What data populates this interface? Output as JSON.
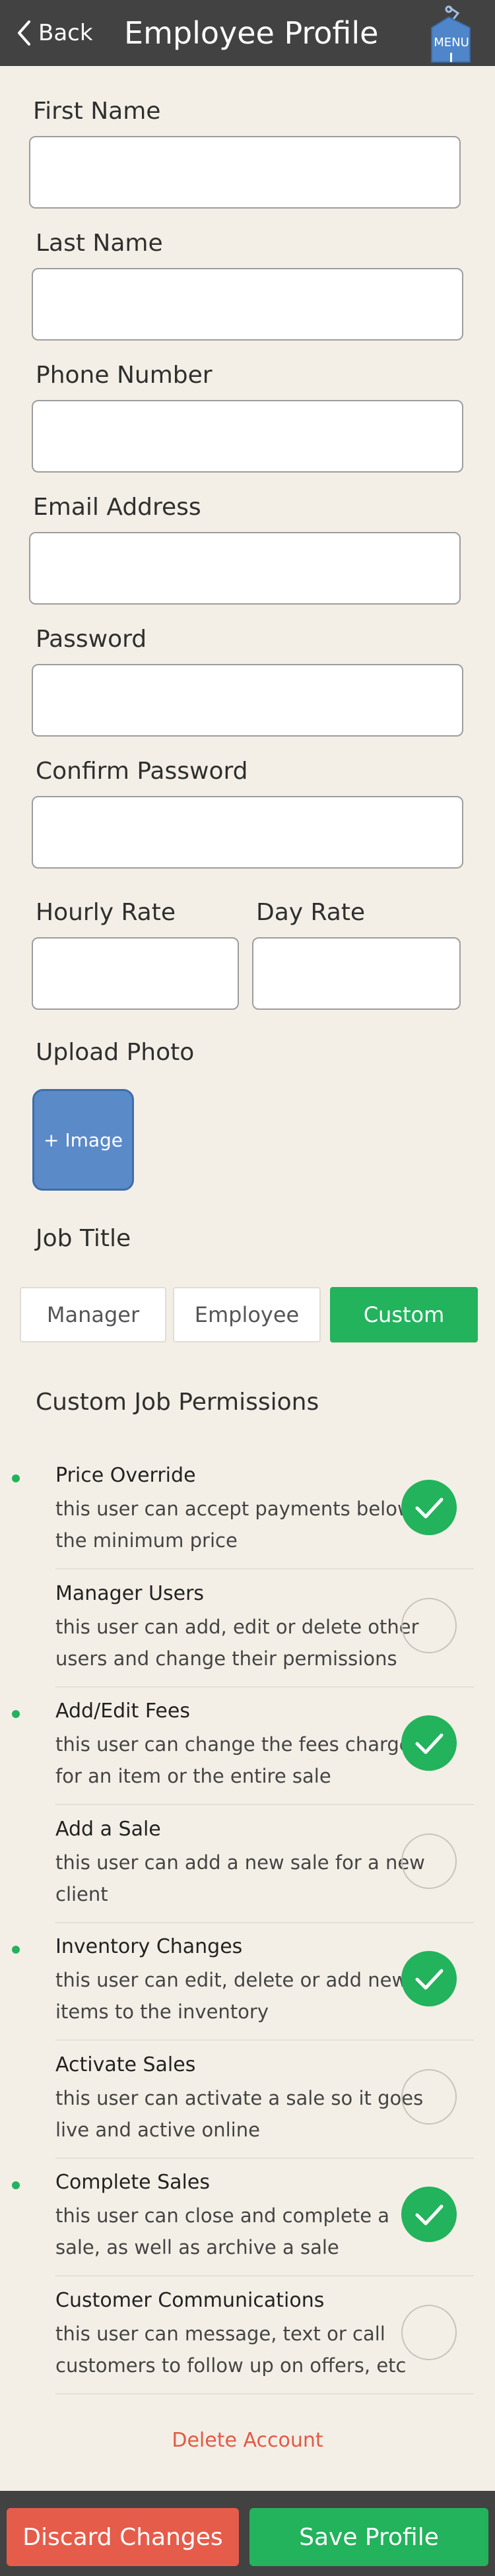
{
  "header": {
    "back_label": "Back",
    "title": "Employee Profile",
    "menu_label": "MENU"
  },
  "form": {
    "first_name": {
      "label": "First Name",
      "value": "",
      "placeholder": ""
    },
    "last_name": {
      "label": "Last Name",
      "value": "",
      "placeholder": ""
    },
    "phone": {
      "label": "Phone Number",
      "value": "",
      "placeholder": ""
    },
    "email": {
      "label": "Email Address",
      "value": "",
      "placeholder": ""
    },
    "password": {
      "label": "Password",
      "value": "",
      "placeholder": ""
    },
    "confirm_password": {
      "label": "Confirm Password",
      "value": "",
      "placeholder": ""
    },
    "hourly_rate": {
      "label": "Hourly Rate",
      "value": "",
      "placeholder": ""
    },
    "day_rate": {
      "label": "Day Rate",
      "value": "",
      "placeholder": ""
    }
  },
  "upload": {
    "label": "Upload Photo",
    "button_label": "+ Image"
  },
  "job_title": {
    "label": "Job Title",
    "options": [
      "Manager",
      "Employee",
      "Custom"
    ],
    "selected": "Custom"
  },
  "permissions": {
    "section_title": "Custom Job Permissions",
    "items": [
      {
        "title": "Price Override",
        "description": "this user can accept payments below the minimum price",
        "enabled": true
      },
      {
        "title": "Manager Users",
        "description": "this user can add, edit or delete other users and change their permissions",
        "enabled": false
      },
      {
        "title": "Add/Edit Fees",
        "description": "this user can change the fees charged for an item or the entire sale",
        "enabled": true
      },
      {
        "title": "Add a Sale",
        "description": "this user can add a new sale for a new client",
        "enabled": false
      },
      {
        "title": "Inventory Changes",
        "description": "this user can edit, delete or add new items to the inventory",
        "enabled": true
      },
      {
        "title": "Activate Sales",
        "description": "this user can activate a sale so it goes live and active online",
        "enabled": false
      },
      {
        "title": "Complete Sales",
        "description": "this user can close and complete a sale, as well as archive a sale",
        "enabled": true
      },
      {
        "title": "Customer Communications",
        "description": "this user can message, text or call customers to follow up on offers, etc",
        "enabled": false
      }
    ]
  },
  "delete_label": "Delete Account",
  "footer": {
    "discard_label": "Discard Changes",
    "save_label": "Save Profile"
  },
  "colors": {
    "header_bg": "#424242",
    "accent_green": "#22b35c",
    "danger_red": "#e65c4a",
    "upload_blue": "#5b8ac8",
    "page_bg": "#f4efe6"
  }
}
